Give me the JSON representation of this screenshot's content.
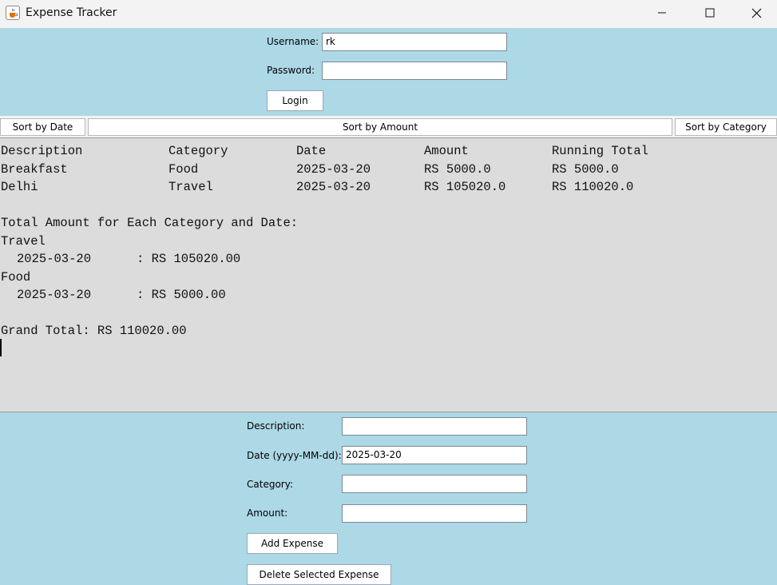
{
  "window": {
    "title": "Expense Tracker"
  },
  "login": {
    "username_label": "Username:",
    "username_value": "rk",
    "password_label": "Password:",
    "password_value": "",
    "login_button": "Login"
  },
  "sort": {
    "by_date": "Sort by Date",
    "by_amount": "Sort by Amount",
    "by_category": "Sort by Category"
  },
  "report": {
    "headers": [
      "Description",
      "Category",
      "Date",
      "Amount",
      "Running Total"
    ],
    "rows": [
      [
        "Breakfast",
        "Food",
        "2025-03-20",
        "RS 5000.0",
        "RS 5000.0"
      ],
      [
        "Delhi",
        "Travel",
        "2025-03-20",
        "RS 105020.0",
        "RS 110020.0"
      ]
    ],
    "summary_title": "Total Amount for Each Category and Date:",
    "groups": [
      {
        "category": "Travel",
        "date": "2025-03-20",
        "total": ": RS 105020.00"
      },
      {
        "category": "Food",
        "date": "2025-03-20",
        "total": ": RS 5000.00"
      }
    ],
    "grand_total": "Grand Total: RS 110020.00"
  },
  "expense_form": {
    "description_label": "Description:",
    "description_value": "",
    "date_label": "Date (yyyy-MM-dd):",
    "date_value": "2025-03-20",
    "category_label": "Category:",
    "category_value": "",
    "amount_label": "Amount:",
    "amount_value": "",
    "add_button": "Add Expense",
    "delete_button": "Delete Selected Expense"
  },
  "icons": {
    "app": "java-cup-icon",
    "minimize": "minimize-icon",
    "maximize": "maximize-icon",
    "close": "close-icon"
  }
}
